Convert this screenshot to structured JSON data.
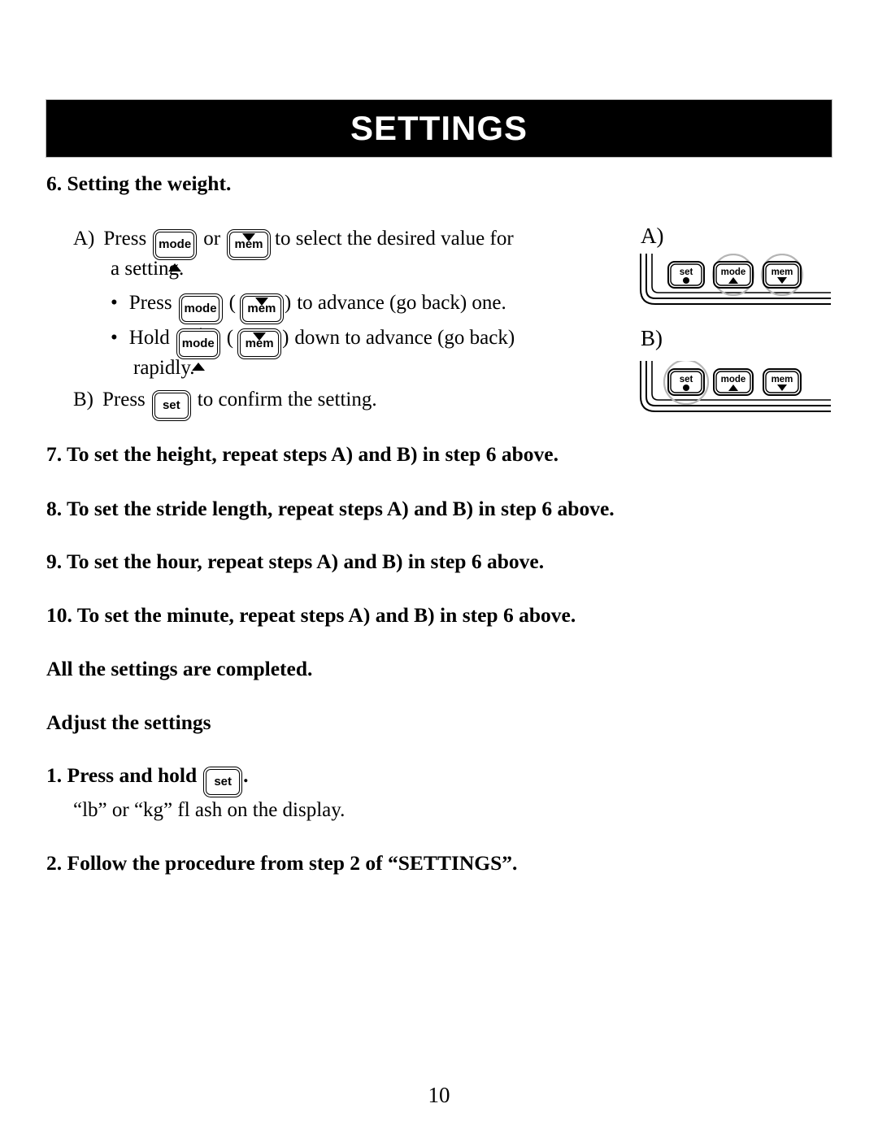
{
  "banner": {
    "title": "SETTINGS"
  },
  "sections": {
    "step6_heading": "6. Setting the weight.",
    "step6": {
      "a_label": "A)",
      "a_text_1": "Press",
      "a_text_2": "or",
      "a_text_3": "to select the desired value for",
      "a_text_4": "a setting.",
      "bullet1_text_1": "Press",
      "bullet1_open_paren": "(",
      "bullet1_close_paren": ")",
      "bullet1_text_2": "to advance (go back) one.",
      "bullet2_text_1": "Hold",
      "bullet2_open_paren": "(",
      "bullet2_close_paren": ")",
      "bullet2_text_2": "down to advance (go back)",
      "bullet2_text_3": "rapidly.",
      "b_label": "B)",
      "b_text_1": "Press",
      "b_text_2": "to confirm the setting."
    },
    "step7": "7.  To set the height, repeat steps A) and B) in step 6 above.",
    "step8": "8.  To set the stride length, repeat steps A) and B) in step 6 above.",
    "step9": "9.  To set the hour, repeat steps A) and B) in step 6 above.",
    "step10": "10. To set the minute, repeat steps A) and B) in step 6 above.",
    "completed": "All the settings are completed.",
    "adjust_heading": "Adjust the settings",
    "adjust_step1_pre": "1.  Press and hold",
    "adjust_step1_post": ".",
    "adjust_step1_note": "“lb” or “kg” fl ash on the display.",
    "adjust_step2": "2.  Follow the procedure from step 2 of “SETTINGS”."
  },
  "keys": {
    "mode_label": "mode",
    "mem_label": "mem",
    "set_label": "set",
    "mode_glyph": "triangle-up-icon",
    "mem_glyph": "triangle-down-icon",
    "set_glyph": "dot-icon"
  },
  "figures": {
    "a": {
      "label": "A)",
      "buttons": [
        "set",
        "mode",
        "mem"
      ],
      "highlighted": [
        "mode",
        "mem"
      ]
    },
    "b": {
      "label": "B)",
      "buttons": [
        "set",
        "mode",
        "mem"
      ],
      "highlighted": [
        "set"
      ]
    }
  },
  "footer": {
    "page_number": "10"
  },
  "colors": {
    "banner_background": "#000000",
    "banner_text": "#ffffff",
    "text": "#000000",
    "highlight_circle": "#b5b5b5",
    "page_background": "#ffffff"
  }
}
